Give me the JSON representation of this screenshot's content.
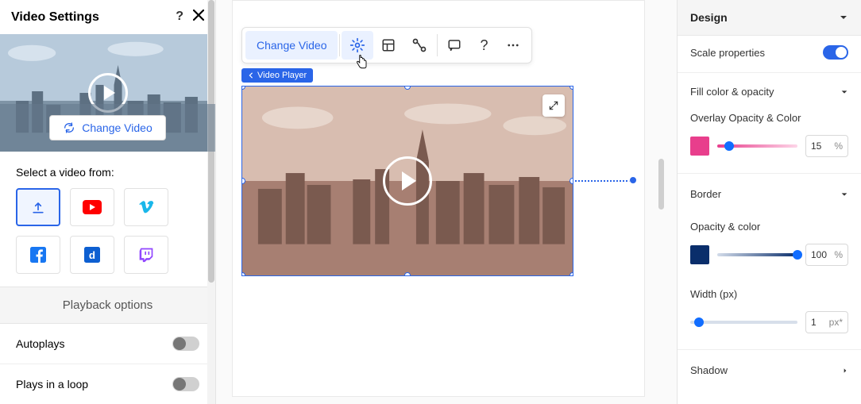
{
  "left_panel": {
    "title": "Video Settings",
    "change_video_label": "Change Video",
    "select_from_label": "Select a video from:",
    "sources": [
      {
        "id": "upload",
        "selected": true
      },
      {
        "id": "youtube",
        "selected": false
      },
      {
        "id": "vimeo",
        "selected": false
      },
      {
        "id": "facebook",
        "selected": false
      },
      {
        "id": "dailymotion",
        "selected": false
      },
      {
        "id": "twitch",
        "selected": false
      }
    ],
    "playback_header": "Playback options",
    "autoplay_label": "Autoplays",
    "autoplay_on": false,
    "loop_label": "Plays in a loop",
    "loop_on": false
  },
  "toolbar": {
    "change_video_label": "Change Video"
  },
  "canvas": {
    "element_tag_label": "Video Player"
  },
  "right_panel": {
    "design_header": "Design",
    "scale_props_label": "Scale properties",
    "scale_on": true,
    "fill_section_label": "Fill color & opacity",
    "overlay_section_label": "Overlay Opacity & Color",
    "overlay_color": "#e83e8c",
    "overlay_opacity": "15",
    "border_section_label": "Border",
    "opacity_color_label": "Opacity & color",
    "border_color": "#0a2e6b",
    "border_opacity": "100",
    "width_label": "Width (px)",
    "width_value": "1",
    "width_unit": "px*",
    "shadow_section_label": "Shadow",
    "unit_percent": "%"
  }
}
